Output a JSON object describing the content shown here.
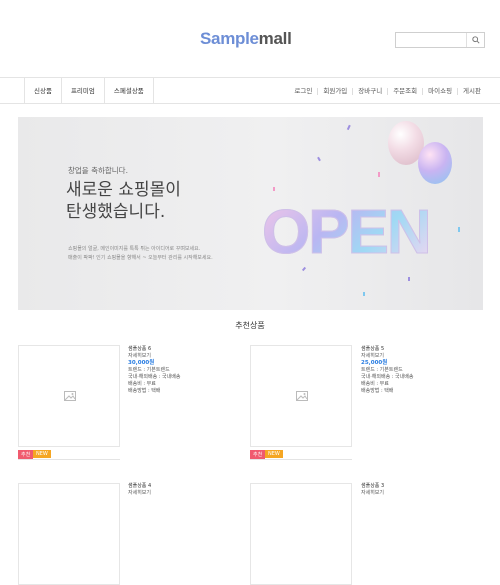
{
  "header": {
    "logo_part1": "Sample",
    "logo_part2": "mall",
    "search_placeholder": "",
    "search_icon": "search-icon"
  },
  "nav": {
    "left": [
      "신상품",
      "프리미엄",
      "스페셜상품"
    ],
    "right": [
      "로그인",
      "회원가입",
      "장바구니",
      "주문조회",
      "마이쇼핑",
      "게시판"
    ]
  },
  "banner": {
    "small": "창업을 축하합니다.",
    "title_line1": "새로운 쇼핑몰이",
    "title_line2": "탄생했습니다.",
    "desc_line1": "쇼핑몰의 얼굴, 메인이미지를 톡톡 튀는 아이디어로 꾸며보세요.",
    "desc_line2": "매출이 팍팍! 인기 쇼핑몰을 향해서 ~ 오늘부터 관리를 시작해보세요.",
    "graphic_text": "OPEN"
  },
  "section_title": "추천상품",
  "products": [
    {
      "name": "샘플상품 6",
      "summary": "자세히보기",
      "price": "30,000원",
      "details": [
        "트렌드 : 기본트렌드",
        "국내·해외배송 : 국내배송",
        "배송비 : 무료",
        "배송방법 : 택배"
      ],
      "tags": [
        "추천",
        "NEW"
      ]
    },
    {
      "name": "샘플상품 5",
      "summary": "자세히보기",
      "price": "25,000원",
      "details": [
        "트렌드 : 기본트렌드",
        "국내·해외배송 : 국내배송",
        "배송비 : 무료",
        "배송방법 : 택배"
      ],
      "tags": [
        "추천",
        "NEW"
      ]
    },
    {
      "name": "샘플상품 4",
      "summary": "자세히보기"
    },
    {
      "name": "샘플상품 3",
      "summary": "자세히보기"
    }
  ],
  "colors": {
    "accent": "#6d8ed6",
    "price": "#2a7de1",
    "tag_recommend": "#f05a6e",
    "tag_new": "#f5a623"
  }
}
